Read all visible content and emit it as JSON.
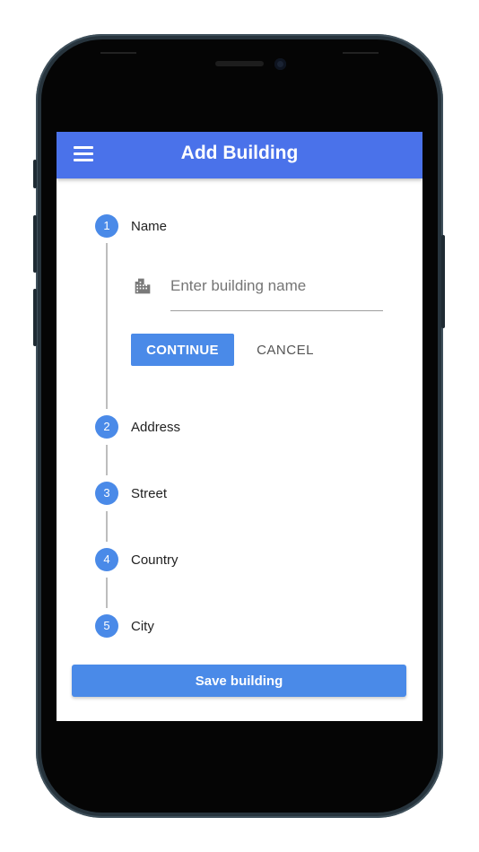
{
  "app_bar": {
    "title": "Add Building",
    "menu_icon": "hamburger-menu-icon",
    "color": "#4a72ea"
  },
  "stepper": {
    "active_step": 1,
    "accent_color": "#4a8ae8",
    "steps": [
      {
        "number": "1",
        "label": "Name"
      },
      {
        "number": "2",
        "label": "Address"
      },
      {
        "number": "3",
        "label": "Street"
      },
      {
        "number": "4",
        "label": "Country"
      },
      {
        "number": "5",
        "label": "City"
      }
    ]
  },
  "name_step": {
    "input_icon": "building-icon",
    "input_placeholder": "Enter building name",
    "input_value": "",
    "continue_label": "CONTINUE",
    "cancel_label": "CANCEL"
  },
  "footer": {
    "save_label": "Save building"
  }
}
